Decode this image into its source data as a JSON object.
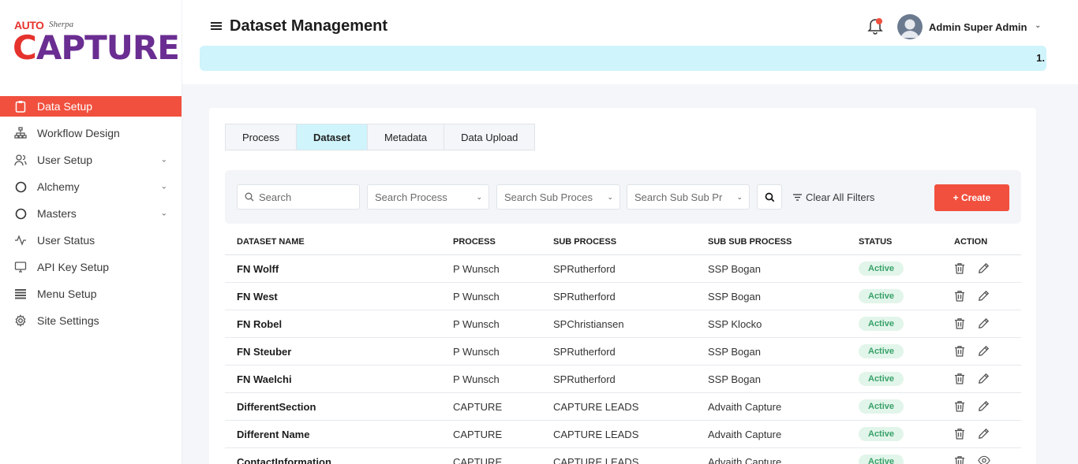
{
  "brand": {
    "auto": "AUTO",
    "sherpa": "Sherpa",
    "capture_c": "C",
    "capture_rest": "APTURE"
  },
  "sidebar": {
    "items": [
      {
        "label": "Data Setup",
        "icon": "clipboard-icon",
        "active": true
      },
      {
        "label": "Workflow Design",
        "icon": "hierarchy-icon"
      },
      {
        "label": "User Setup",
        "icon": "users-icon",
        "has_children": true
      },
      {
        "label": "Alchemy",
        "icon": "circle-icon",
        "has_children": true
      },
      {
        "label": "Masters",
        "icon": "circle-icon",
        "has_children": true
      },
      {
        "label": "User Status",
        "icon": "activity-icon"
      },
      {
        "label": "API Key Setup",
        "icon": "monitor-icon"
      },
      {
        "label": "Menu Setup",
        "icon": "list-icon"
      },
      {
        "label": "Site Settings",
        "icon": "gear-icon"
      }
    ]
  },
  "header": {
    "title": "Dataset Management",
    "user_name": "Admin Super Admin",
    "ticker_text": "1."
  },
  "tabs": [
    {
      "label": "Process"
    },
    {
      "label": "Dataset",
      "active": true
    },
    {
      "label": "Metadata"
    },
    {
      "label": "Data Upload"
    }
  ],
  "filters": {
    "search_placeholder": "Search",
    "process_placeholder": "Search Process",
    "sub_process_placeholder": "Search Sub Proces",
    "sub_sub_process_placeholder": "Search Sub Sub Pr",
    "clear_label": "Clear All Filters",
    "create_label": "+ Create"
  },
  "table": {
    "headers": [
      "DATASET NAME",
      "PROCESS",
      "SUB PROCESS",
      "SUB SUB PROCESS",
      "STATUS",
      "ACTION"
    ],
    "rows": [
      {
        "name": "FN Wolff",
        "process": "P Wunsch",
        "sub": "SPRutherford",
        "subsub": "SSP Bogan",
        "status": "Active",
        "second_action": "edit"
      },
      {
        "name": "FN West",
        "process": "P Wunsch",
        "sub": "SPRutherford",
        "subsub": "SSP Bogan",
        "status": "Active",
        "second_action": "edit"
      },
      {
        "name": "FN Robel",
        "process": "P Wunsch",
        "sub": "SPChristiansen",
        "subsub": "SSP Klocko",
        "status": "Active",
        "second_action": "edit"
      },
      {
        "name": "FN Steuber",
        "process": "P Wunsch",
        "sub": "SPRutherford",
        "subsub": "SSP Bogan",
        "status": "Active",
        "second_action": "edit"
      },
      {
        "name": "FN Waelchi",
        "process": "P Wunsch",
        "sub": "SPRutherford",
        "subsub": "SSP Bogan",
        "status": "Active",
        "second_action": "edit"
      },
      {
        "name": "DifferentSection",
        "process": "CAPTURE",
        "sub": "CAPTURE LEADS",
        "subsub": "Advaith Capture",
        "status": "Active",
        "second_action": "edit"
      },
      {
        "name": "Different Name",
        "process": "CAPTURE",
        "sub": "CAPTURE LEADS",
        "subsub": "Advaith Capture",
        "status": "Active",
        "second_action": "edit"
      },
      {
        "name": "ContactInformation",
        "process": "CAPTURE",
        "sub": "CAPTURE LEADS",
        "subsub": "Advaith Capture",
        "status": "Active",
        "second_action": "view"
      }
    ]
  },
  "colors": {
    "accent": "#f1503e",
    "brand_purple": "#6a2d91",
    "active_tab": "#cff4fc",
    "badge_bg": "#e2f5ea",
    "badge_text": "#38a169"
  }
}
